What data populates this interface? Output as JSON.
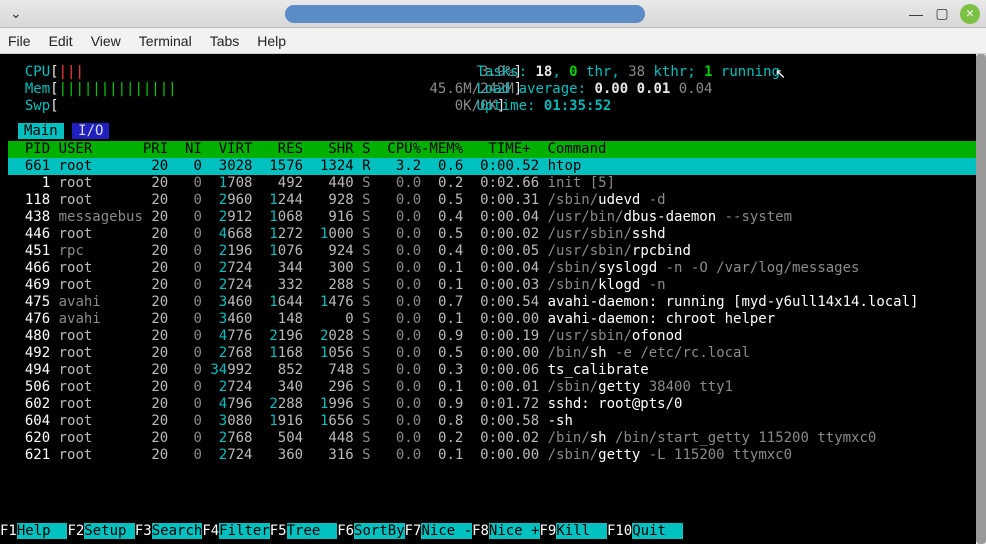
{
  "window": {
    "menu": [
      "File",
      "Edit",
      "View",
      "Terminal",
      "Tabs",
      "Help"
    ]
  },
  "meters": {
    "cpu": {
      "label": "CPU",
      "bar": "|||",
      "pct": "3.9%"
    },
    "mem": {
      "label": "Mem",
      "bar": "||||||||||||||",
      "used": "45.6M",
      "total": "242M"
    },
    "swp": {
      "label": "Swp",
      "bar": "",
      "used": "0K",
      "total": "0K"
    },
    "tasks": {
      "label": "Tasks:",
      "count": "18",
      "thr": "0",
      "kthr": "38",
      "running": "1"
    },
    "load": {
      "label": "Load average:",
      "v1": "0.00",
      "v2": "0.01",
      "v3": "0.04"
    },
    "uptime": {
      "label": "Uptime:",
      "value": "01:35:52"
    }
  },
  "tabs": {
    "main": "Main",
    "io": "I/O"
  },
  "columns": "  PID USER      PRI  NI  VIRT   RES   SHR S  CPU%-MEM%   TIME+  Command",
  "processes": [
    {
      "pid": "661",
      "user": "root",
      "pri": "20",
      "ni": "0",
      "virt": "3028",
      "res": "1576",
      "shr": "1324",
      "s": "R",
      "cpu": "3.2",
      "mem": "0.6",
      "time": "0:00.52",
      "cmd": "htop",
      "sel": true
    },
    {
      "pid": "1",
      "user": "root",
      "pri": "20",
      "ni": "0",
      "virt": "1708",
      "res": "492",
      "shr": "440",
      "s": "S",
      "cpu": "0.0",
      "mem": "0.2",
      "time": "0:02.66",
      "cmd": "init [5]",
      "cmdGrey": "init ",
      "cmdTail": "[5]"
    },
    {
      "pid": "118",
      "user": "root",
      "pri": "20",
      "ni": "0",
      "virt": "2960",
      "res": "1244",
      "shr": "928",
      "s": "S",
      "cpu": "0.0",
      "mem": "0.5",
      "time": "0:00.31",
      "cmd": "/sbin/udevd -d",
      "cmdGrey": "/sbin/",
      "cmdRest": "udevd ",
      "cmdTail": "-d"
    },
    {
      "pid": "438",
      "user": "messagebus",
      "userGrey": true,
      "pri": "20",
      "ni": "0",
      "virt": "2912",
      "res": "1068",
      "shr": "916",
      "s": "S",
      "cpu": "0.0",
      "mem": "0.4",
      "time": "0:00.04",
      "cmd": "/usr/bin/dbus-daemon --system",
      "cmdGrey": "/usr/bin/",
      "cmdRest": "dbus-daemon ",
      "cmdTail": "--system"
    },
    {
      "pid": "446",
      "user": "root",
      "pri": "20",
      "ni": "0",
      "virt": "4668",
      "res": "1272",
      "shr": "1000",
      "s": "S",
      "cpu": "0.0",
      "mem": "0.5",
      "time": "0:00.02",
      "cmd": "/usr/sbin/sshd",
      "cmdGrey": "/usr/sbin/",
      "cmdRest": "sshd"
    },
    {
      "pid": "451",
      "user": "rpc",
      "userGrey": true,
      "pri": "20",
      "ni": "0",
      "virt": "2196",
      "res": "1076",
      "shr": "924",
      "s": "S",
      "cpu": "0.0",
      "mem": "0.4",
      "time": "0:00.05",
      "cmd": "/usr/sbin/rpcbind",
      "cmdGrey": "/usr/sbin/",
      "cmdRest": "rpcbind"
    },
    {
      "pid": "466",
      "user": "root",
      "pri": "20",
      "ni": "0",
      "virt": "2724",
      "res": "344",
      "shr": "300",
      "s": "S",
      "cpu": "0.0",
      "mem": "0.1",
      "time": "0:00.04",
      "cmd": "/sbin/syslogd -n -O /var/log/messages",
      "cmdGrey": "/sbin/",
      "cmdRest": "syslogd ",
      "cmdTail": "-n -O /var/log/messages"
    },
    {
      "pid": "469",
      "user": "root",
      "pri": "20",
      "ni": "0",
      "virt": "2724",
      "res": "332",
      "shr": "288",
      "s": "S",
      "cpu": "0.0",
      "mem": "0.1",
      "time": "0:00.03",
      "cmd": "/sbin/klogd -n",
      "cmdGrey": "/sbin/",
      "cmdRest": "klogd ",
      "cmdTail": "-n"
    },
    {
      "pid": "475",
      "user": "avahi",
      "userGrey": true,
      "pri": "20",
      "ni": "0",
      "virt": "3460",
      "res": "1644",
      "shr": "1476",
      "s": "S",
      "cpu": "0.0",
      "mem": "0.7",
      "time": "0:00.54",
      "cmd": "avahi-daemon: running [myd-y6ull14x14.local]"
    },
    {
      "pid": "476",
      "user": "avahi",
      "userGrey": true,
      "pri": "20",
      "ni": "0",
      "virt": "3460",
      "res": "148",
      "shr": "0",
      "s": "S",
      "cpu": "0.0",
      "mem": "0.1",
      "time": "0:00.00",
      "cmd": "avahi-daemon: chroot helper"
    },
    {
      "pid": "480",
      "user": "root",
      "pri": "20",
      "ni": "0",
      "virt": "4776",
      "res": "2196",
      "shr": "2028",
      "s": "S",
      "cpu": "0.0",
      "mem": "0.9",
      "time": "0:00.19",
      "cmd": "/usr/sbin/ofonod",
      "cmdGrey": "/usr/sbin/",
      "cmdRest": "ofonod"
    },
    {
      "pid": "492",
      "user": "root",
      "pri": "20",
      "ni": "0",
      "virt": "2768",
      "res": "1168",
      "shr": "1056",
      "s": "S",
      "cpu": "0.0",
      "mem": "0.5",
      "time": "0:00.00",
      "cmd": "/bin/sh -e /etc/rc.local",
      "cmdGrey": "/bin/",
      "cmdRest": "sh ",
      "cmdTail": "-e /etc/rc.local"
    },
    {
      "pid": "494",
      "user": "root",
      "pri": "20",
      "ni": "0",
      "virt": "34992",
      "res": "852",
      "shr": "748",
      "s": "S",
      "cpu": "0.0",
      "mem": "0.3",
      "time": "0:00.06",
      "cmd": "ts_calibrate"
    },
    {
      "pid": "506",
      "user": "root",
      "pri": "20",
      "ni": "0",
      "virt": "2724",
      "res": "340",
      "shr": "296",
      "s": "S",
      "cpu": "0.0",
      "mem": "0.1",
      "time": "0:00.01",
      "cmd": "/sbin/getty 38400 tty1",
      "cmdGrey": "/sbin/",
      "cmdRest": "getty ",
      "cmdTail": "38400 tty1"
    },
    {
      "pid": "602",
      "user": "root",
      "pri": "20",
      "ni": "0",
      "virt": "4796",
      "res": "2288",
      "shr": "1996",
      "s": "S",
      "cpu": "0.0",
      "mem": "0.9",
      "time": "0:01.72",
      "cmd": "sshd: root@pts/0"
    },
    {
      "pid": "604",
      "user": "root",
      "pri": "20",
      "ni": "0",
      "virt": "3080",
      "res": "1916",
      "shr": "1656",
      "s": "S",
      "cpu": "0.0",
      "mem": "0.8",
      "time": "0:00.58",
      "cmd": "-sh"
    },
    {
      "pid": "620",
      "user": "root",
      "pri": "20",
      "ni": "0",
      "virt": "2768",
      "res": "504",
      "shr": "448",
      "s": "S",
      "cpu": "0.0",
      "mem": "0.2",
      "time": "0:00.02",
      "cmd": "/bin/sh /bin/start_getty 115200 ttymxc0",
      "cmdGrey": "/bin/",
      "cmdRest": "sh ",
      "cmdTail": "/bin/start_getty 115200 ttymxc0"
    },
    {
      "pid": "621",
      "user": "root",
      "pri": "20",
      "ni": "0",
      "virt": "2724",
      "res": "360",
      "shr": "316",
      "s": "S",
      "cpu": "0.0",
      "mem": "0.1",
      "time": "0:00.00",
      "cmd": "/sbin/getty -L 115200 ttymxc0",
      "cmdGrey": "/sbin/",
      "cmdRest": "getty ",
      "cmdTail": "-L 115200 ttymxc0"
    }
  ],
  "footer": [
    {
      "key": "F1",
      "label": "Help  "
    },
    {
      "key": "F2",
      "label": "Setup "
    },
    {
      "key": "F3",
      "label": "Search"
    },
    {
      "key": "F4",
      "label": "Filter"
    },
    {
      "key": "F5",
      "label": "Tree  "
    },
    {
      "key": "F6",
      "label": "SortBy"
    },
    {
      "key": "F7",
      "label": "Nice -"
    },
    {
      "key": "F8",
      "label": "Nice +"
    },
    {
      "key": "F9",
      "label": "Kill  "
    },
    {
      "key": "F10",
      "label": "Quit  "
    }
  ]
}
